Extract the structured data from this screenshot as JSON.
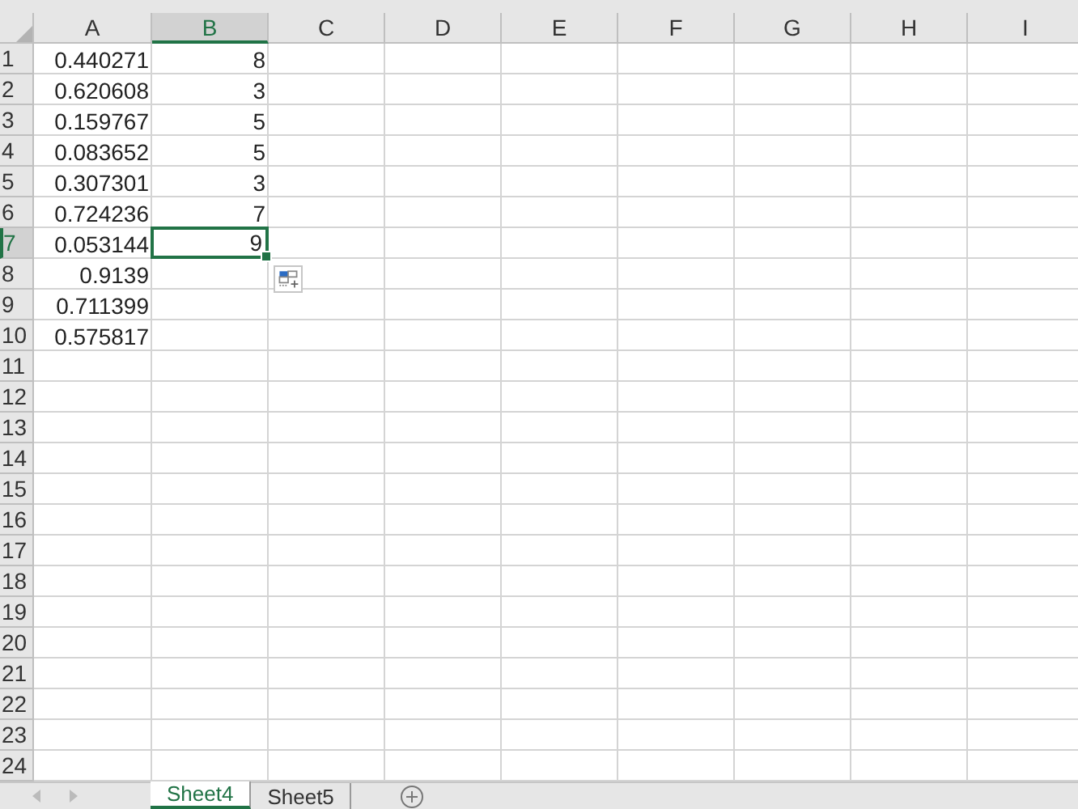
{
  "columns": [
    {
      "label": "A",
      "selected": false
    },
    {
      "label": "B",
      "selected": true
    },
    {
      "label": "C",
      "selected": false
    },
    {
      "label": "D",
      "selected": false
    },
    {
      "label": "E",
      "selected": false
    },
    {
      "label": "F",
      "selected": false
    },
    {
      "label": "G",
      "selected": false
    },
    {
      "label": "H",
      "selected": false
    },
    {
      "label": "I",
      "selected": false
    }
  ],
  "rows": [
    {
      "label": "1",
      "selected": false,
      "cells": [
        {
          "text": "0.440271",
          "selected": false
        },
        {
          "text": "8",
          "selected": false
        }
      ]
    },
    {
      "label": "2",
      "selected": false,
      "cells": [
        {
          "text": "0.620608",
          "selected": false
        },
        {
          "text": "3",
          "selected": false
        }
      ]
    },
    {
      "label": "3",
      "selected": false,
      "cells": [
        {
          "text": "0.159767",
          "selected": false
        },
        {
          "text": "5",
          "selected": false
        }
      ]
    },
    {
      "label": "4",
      "selected": false,
      "cells": [
        {
          "text": "0.083652",
          "selected": false
        },
        {
          "text": "5",
          "selected": false
        }
      ]
    },
    {
      "label": "5",
      "selected": false,
      "cells": [
        {
          "text": "0.307301",
          "selected": false
        },
        {
          "text": "3",
          "selected": false
        }
      ]
    },
    {
      "label": "6",
      "selected": false,
      "cells": [
        {
          "text": "0.724236",
          "selected": false
        },
        {
          "text": "7",
          "selected": false
        }
      ]
    },
    {
      "label": "7",
      "selected": true,
      "cells": [
        {
          "text": "0.053144",
          "selected": false
        },
        {
          "text": "9",
          "selected": true
        }
      ]
    },
    {
      "label": "8",
      "selected": false,
      "cells": [
        {
          "text": "0.9139",
          "selected": false
        }
      ]
    },
    {
      "label": "9",
      "selected": false,
      "cells": [
        {
          "text": "0.711399",
          "selected": false
        }
      ]
    },
    {
      "label": "10",
      "selected": false,
      "cells": [
        {
          "text": "0.575817",
          "selected": false
        }
      ]
    },
    {
      "label": "11",
      "selected": false
    },
    {
      "label": "12",
      "selected": false
    },
    {
      "label": "13",
      "selected": false
    },
    {
      "label": "14",
      "selected": false
    },
    {
      "label": "15",
      "selected": false
    },
    {
      "label": "16",
      "selected": false
    },
    {
      "label": "17",
      "selected": false
    },
    {
      "label": "18",
      "selected": false
    },
    {
      "label": "19",
      "selected": false
    },
    {
      "label": "20",
      "selected": false
    },
    {
      "label": "21",
      "selected": false
    },
    {
      "label": "22",
      "selected": false
    },
    {
      "label": "23",
      "selected": false
    },
    {
      "label": "24",
      "selected": false
    }
  ],
  "tabs": [
    {
      "label": "Sheet4",
      "selected": true
    },
    {
      "label": "Sheet5",
      "selected": false
    }
  ]
}
